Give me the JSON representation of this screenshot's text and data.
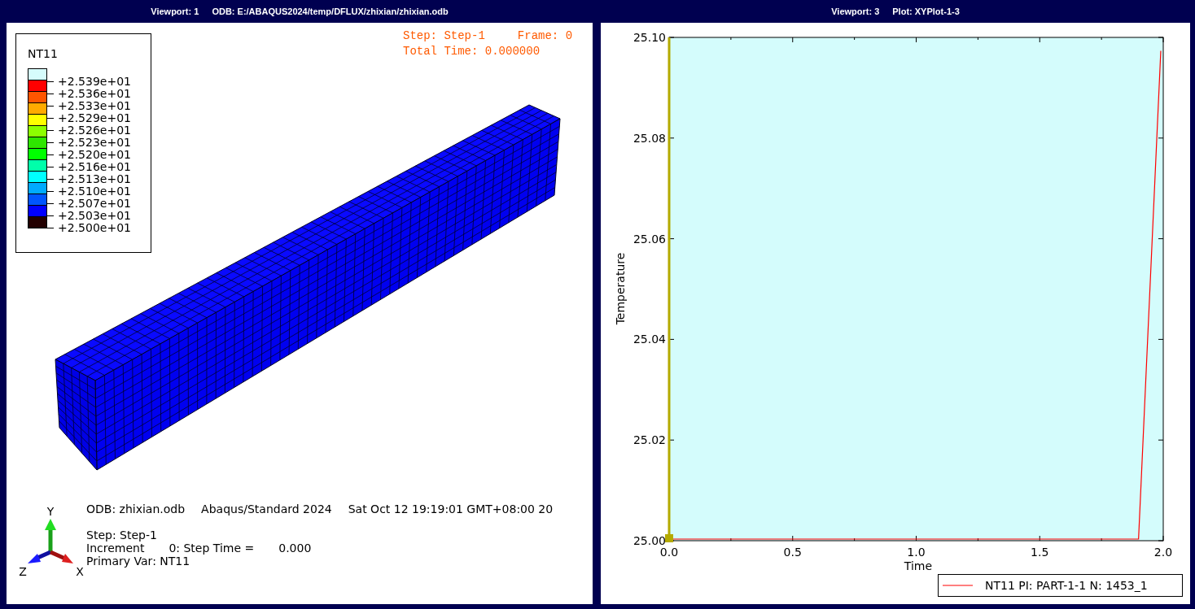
{
  "viewports": [
    {
      "number": "Viewport: 1",
      "source": "ODB: E:/ABAQUS2024/temp/DFLUX/zhixian/zhixian.odb"
    },
    {
      "number": "Viewport: 3",
      "source": "Plot: XYPlot-1-3"
    }
  ],
  "contour_legend": {
    "title": "NT11",
    "swatches": [
      {
        "color": "#d6fcfc"
      },
      {
        "color": "#ff0000"
      },
      {
        "color": "#ff5500"
      },
      {
        "color": "#ffaa00"
      },
      {
        "color": "#ffff00"
      },
      {
        "color": "#8cff00"
      },
      {
        "color": "#2ee600"
      },
      {
        "color": "#00ff00"
      },
      {
        "color": "#00ffaa"
      },
      {
        "color": "#00ffff"
      },
      {
        "color": "#00aaff"
      },
      {
        "color": "#0055ff"
      },
      {
        "color": "#0000ff"
      },
      {
        "color": "#220000"
      }
    ],
    "values": [
      "+2.539e+01",
      "+2.536e+01",
      "+2.533e+01",
      "+2.529e+01",
      "+2.526e+01",
      "+2.523e+01",
      "+2.520e+01",
      "+2.516e+01",
      "+2.513e+01",
      "+2.510e+01",
      "+2.507e+01",
      "+2.503e+01",
      "+2.500e+01"
    ]
  },
  "state_block": {
    "line_1": [
      "Step: Step-1",
      "Frame: 0"
    ],
    "line_2": "Total Time: 0.000000"
  },
  "triad": {
    "labels": [
      "Y",
      "Z",
      "X"
    ]
  },
  "info": {
    "odb": "ODB: zhixian.odb",
    "solver": "Abaqus/Standard 2024",
    "date": "Sat Oct 12 19:19:01 GMT+08:00 20",
    "step": "Step: Step-1",
    "increment": [
      "Increment",
      "0: Step Time =",
      "0.000"
    ],
    "primary_var": "Primary Var: NT11"
  },
  "chart_data": {
    "type": "line",
    "xlabel": "Time",
    "ylabel": "Temperature",
    "x": [
      0,
      1.9,
      1.99
    ],
    "series": [
      {
        "name": "NT11 PI: PART-1-1 N: 1453_1",
        "color": "#ff0000",
        "values": [
          25.0,
          25.0,
          25.097
        ]
      }
    ],
    "xlim": [
      0,
      2
    ],
    "ylim": [
      25.0,
      25.1
    ],
    "xticks": [
      {
        "value": 0,
        "label": "0.0"
      },
      {
        "value": 0.5,
        "label": "0.5"
      },
      {
        "value": 1,
        "label": "1.0"
      },
      {
        "value": 1.5,
        "label": "1.5"
      },
      {
        "value": 2,
        "label": "2.0"
      }
    ],
    "yticks": [
      {
        "value": 25.0,
        "label": "25.00"
      },
      {
        "value": 25.02,
        "label": "25.02"
      },
      {
        "value": 25.04,
        "label": "25.04"
      },
      {
        "value": 25.06,
        "label": "25.06"
      },
      {
        "value": 25.08,
        "label": "25.08"
      },
      {
        "value": 25.1,
        "label": "25.10"
      }
    ]
  }
}
